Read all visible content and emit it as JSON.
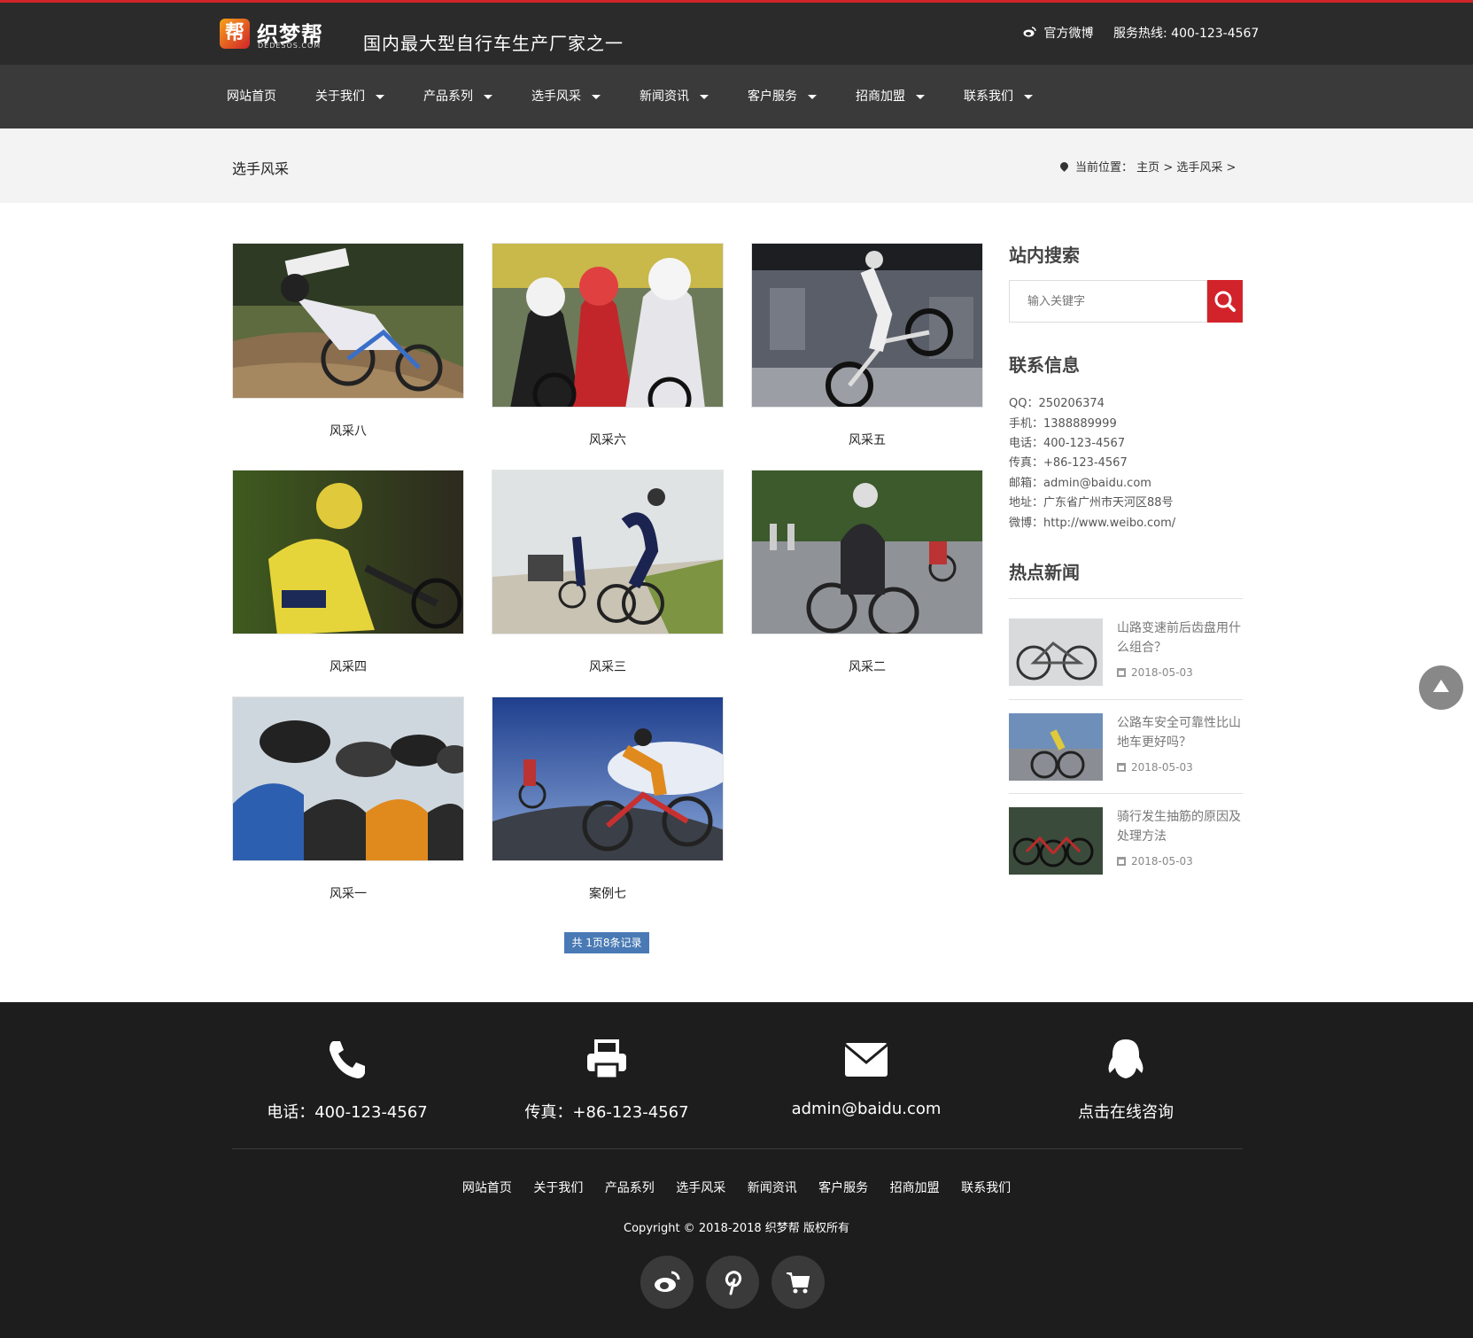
{
  "header": {
    "logo_mark": "帮",
    "logo_text": "织梦帮",
    "logo_sub": "DEDESOS.COM",
    "slogan": "国内最大型自行车生产厂家之一",
    "weibo_label": "官方微博",
    "hotline": "服务热线: 400-123-4567"
  },
  "nav": [
    {
      "label": "网站首页",
      "has_caret": false
    },
    {
      "label": "关于我们",
      "has_caret": true
    },
    {
      "label": "产品系列",
      "has_caret": true
    },
    {
      "label": "选手风采",
      "has_caret": true
    },
    {
      "label": "新闻资讯",
      "has_caret": true
    },
    {
      "label": "客户服务",
      "has_caret": true
    },
    {
      "label": "招商加盟",
      "has_caret": true
    },
    {
      "label": "联系我们",
      "has_caret": true
    }
  ],
  "breadcrumb": {
    "section_title": "选手风采",
    "prefix": "当前位置：",
    "home": "主页",
    "sep1": ">",
    "current": "选手风采",
    "sep2": ">"
  },
  "gallery": [
    {
      "caption": "风采八",
      "scene": "mtb"
    },
    {
      "caption": "风采六",
      "scene": "peloton"
    },
    {
      "caption": "风采五",
      "scene": "garage"
    },
    {
      "caption": "风采四",
      "scene": "yellow"
    },
    {
      "caption": "风采三",
      "scene": "road"
    },
    {
      "caption": "风采二",
      "scene": "race"
    },
    {
      "caption": "风采一",
      "scene": "team"
    },
    {
      "caption": "案例七",
      "scene": "sky"
    }
  ],
  "pager": "共 1页8条记录",
  "sidebar": {
    "search_title": "站内搜索",
    "search_placeholder": "输入关键字",
    "contact_title": "联系信息",
    "contact": [
      "QQ：250206374",
      "手机：1388889999",
      "电话：400-123-4567",
      "传真：+86-123-4567",
      "邮箱：admin@baidu.com",
      "地址：广东省广州市天河区88号",
      "微博：http://www.weibo.com/"
    ],
    "hot_title": "热点新闻",
    "news": [
      {
        "title": "山路变速前后齿盘用什么组合？",
        "date": "2018-05-03"
      },
      {
        "title": "公路车安全可靠性比山地车更好吗？",
        "date": "2018-05-03"
      },
      {
        "title": "骑行发生抽筋的原因及处理方法",
        "date": "2018-05-03"
      }
    ]
  },
  "footer": {
    "phone": "电话：400-123-4567",
    "fax": "传真：+86-123-4567",
    "email": "admin@baidu.com",
    "consult": "点击在线咨询",
    "links": [
      "网站首页",
      "关于我们",
      "产品系列",
      "选手风采",
      "新闻资讯",
      "客户服务",
      "招商加盟",
      "联系我们"
    ],
    "copyright": "Copyright © 2018-2018 织梦帮 版权所有"
  },
  "colors": {
    "accent_red": "#d2232a",
    "topbar": "#2b2b2b",
    "nav": "#3a3a3a",
    "footer": "#1d1d1d",
    "pager": "#4a7ab5"
  }
}
